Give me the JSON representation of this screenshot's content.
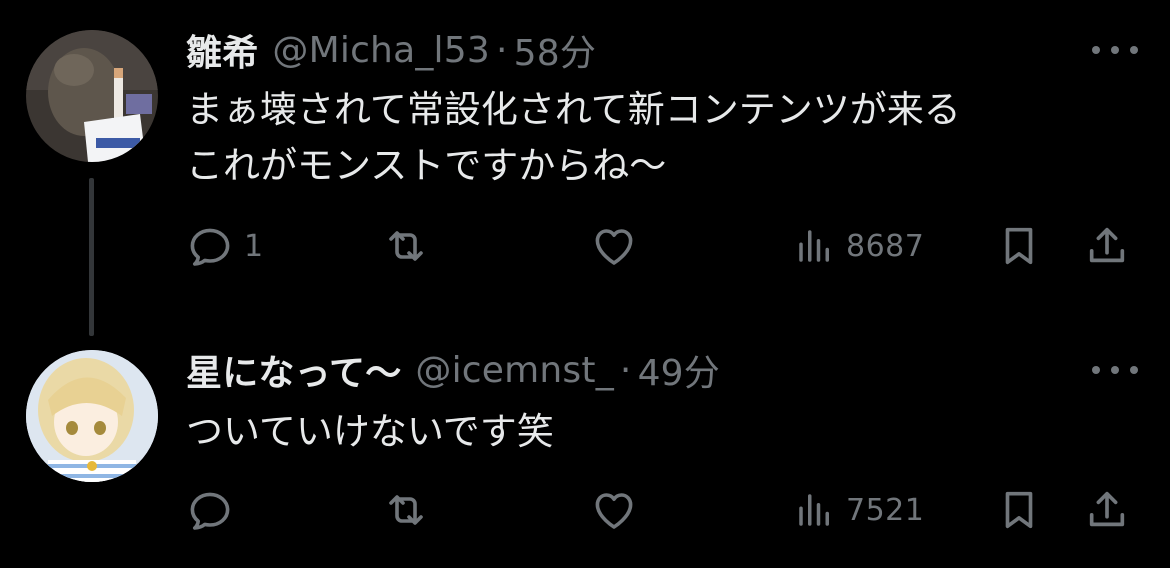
{
  "colors": {
    "background": "#000000",
    "primary_text": "#e7e9ea",
    "secondary_text": "#71767b",
    "thread_line": "#333639"
  },
  "tweets": [
    {
      "display_name": "雛希",
      "handle": "@Micha_l53",
      "separator": "·",
      "time": "58分",
      "text_lines": [
        "まぁ壊されて常設化されて新コンテンツが来る",
        "これがモンストですからね〜"
      ],
      "reply_count": "1",
      "views": "8687",
      "icons": [
        "reply-icon",
        "retweet-icon",
        "like-icon",
        "views-icon",
        "bookmark-icon",
        "share-icon"
      ]
    },
    {
      "display_name": "星になって〜",
      "handle": "@icemnst_",
      "separator": "·",
      "time": "49分",
      "text_lines": [
        "ついていけないです笑"
      ],
      "reply_count": "",
      "views": "7521",
      "icons": [
        "reply-icon",
        "retweet-icon",
        "like-icon",
        "views-icon",
        "bookmark-icon",
        "share-icon"
      ]
    }
  ]
}
